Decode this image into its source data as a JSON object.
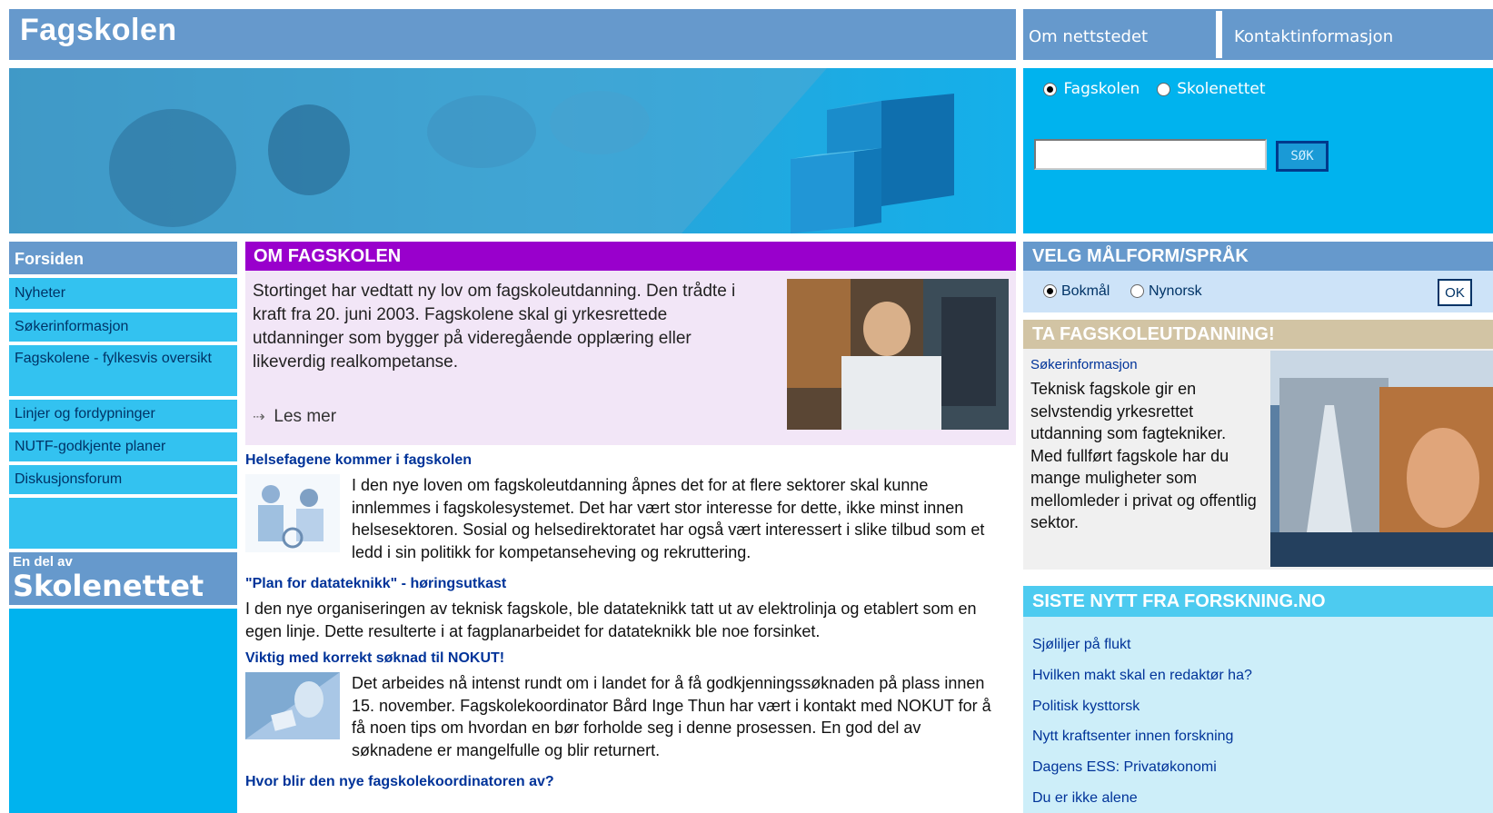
{
  "header": {
    "site_title": "Fagskolen",
    "links": [
      "Om nettstedet",
      "Kontaktinformasjon"
    ]
  },
  "search": {
    "options": [
      "Fagskolen",
      "Skolenettet"
    ],
    "selected": "Fagskolen",
    "input_value": "",
    "button_label": "SØK"
  },
  "leftnav": {
    "items": [
      "Forsiden",
      "Nyheter",
      "Søkerinformasjon",
      "Fagskolene - fylkesvis oversikt",
      "Linjer og fordypninger",
      "NUTF-godkjente planer",
      "Diskusjonsforum"
    ],
    "active": "Forsiden",
    "skolenettet_pre": "En del av",
    "skolenettet_logo": "Skolenettet"
  },
  "main": {
    "om_title": "OM FAGSKOLEN",
    "om_text": "Stortinget har vedtatt ny lov om fagskoleutdanning. Den trådte i kraft fra 20. juni 2003. Fagskolene skal gi yrkesrettede utdanninger som bygger på videregående opplæring eller likeverdig realkompetanse.",
    "les_mer": "Les mer",
    "news": [
      {
        "title": "Helsefagene kommer i fagskolen",
        "text": "I den nye loven om fagskoleutdanning åpnes det for at flere sektorer skal kunne innlemmes i fagskolesystemet. Det har vært stor interesse for dette, ikke minst innen helsesektoren. Sosial og helsedirektoratet har også vært interessert i slike tilbud som et ledd i sin politikk for kompetanseheving og rekruttering."
      },
      {
        "title": "\"Plan for datateknikk\" - høringsutkast",
        "text": "I den nye organiseringen av teknisk fagskole, ble datateknikk tatt ut av elektrolinja og etablert som en egen linje. Dette resulterte i at fagplanarbeidet for datateknikk ble noe forsinket."
      },
      {
        "title": "Viktig med korrekt søknad til NOKUT!",
        "text": "Det arbeides nå intenst rundt om i landet for å få godkjenningssøknaden på plass innen 15. november. Fagskolekoordinator Bård Inge Thun har vært i kontakt med NOKUT for å få noen tips om hvordan en bør forholde seg i denne prosessen. En god del av søknadene er mangelfulle og blir returnert."
      },
      {
        "title": "Hvor blir den nye fagskolekoordinatoren av?",
        "text": ""
      }
    ]
  },
  "right": {
    "lang_title": "VELG MÅLFORM/SPRÅK",
    "lang_options": [
      "Bokmål",
      "Nynorsk"
    ],
    "lang_selected": "Bokmål",
    "ok_label": "OK",
    "ta_title": "TA FAGSKOLEUTDANNING!",
    "ta_link": "Søkerinformasjon",
    "ta_text": "Teknisk fagskole gir en selvstendig yrkesrettet utdanning som fagtekniker. Med fullført fagskole har du mange muligheter som mellomleder i privat og offentlig sektor.",
    "siste_title": "SISTE NYTT FRA FORSKNING.NO",
    "siste_items": [
      "Sjøliljer på flukt",
      "Hvilken makt skal en redaktør ha?",
      "Politisk kysttorsk",
      "Nytt kraftsenter innen forskning",
      "Dagens ESS: Privatøkonomi",
      "Du er ikke alene"
    ]
  },
  "colors": {
    "header_blue": "#6699cc",
    "banner_cyan": "#00b3ee",
    "purple": "#9900cc",
    "link_blue": "#003399"
  }
}
